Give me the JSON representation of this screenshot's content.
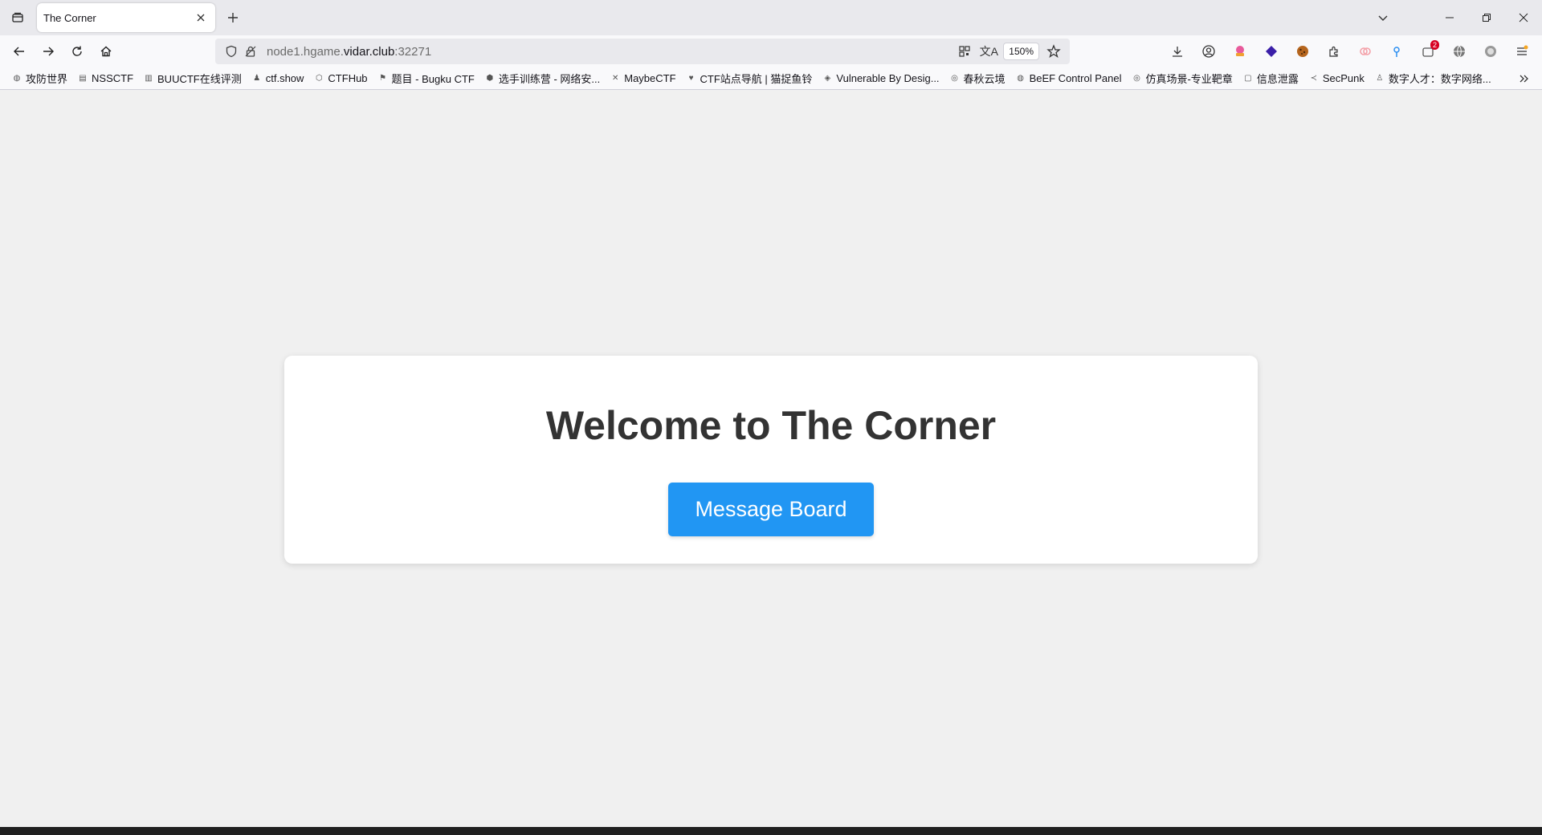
{
  "tab": {
    "title": "The Corner"
  },
  "url": {
    "prefix": "node1.hgame.",
    "domain": "vidar.club",
    "suffix": ":32271"
  },
  "zoom": "150%",
  "extensions": {
    "badge_count": "2"
  },
  "bookmarks": [
    {
      "label": "攻防世界",
      "icon": "globe-icon"
    },
    {
      "label": "NSSCTF",
      "icon": "nss-icon"
    },
    {
      "label": "BUUCTF在线评测",
      "icon": "buu-icon"
    },
    {
      "label": "ctf.show",
      "icon": "runner-icon"
    },
    {
      "label": "CTFHub",
      "icon": "hub-icon"
    },
    {
      "label": "题目 - Bugku CTF",
      "icon": "flag-icon"
    },
    {
      "label": "选手训练营 - 网络安...",
      "icon": "shield-icon"
    },
    {
      "label": "MaybeCTF",
      "icon": "bird-icon"
    },
    {
      "label": "CTF站点导航 | 猫捉鱼铃",
      "icon": "cat-icon"
    },
    {
      "label": "Vulnerable By Desig...",
      "icon": "cube-icon"
    },
    {
      "label": "春秋云境",
      "icon": "swirl-icon"
    },
    {
      "label": "BeEF Control Panel",
      "icon": "globe-icon"
    },
    {
      "label": "仿真场景-专业靶章",
      "icon": "swirl-icon"
    },
    {
      "label": "信息泄露",
      "icon": "square-icon"
    },
    {
      "label": "SecPunk",
      "icon": "arrow-icon"
    },
    {
      "label": "数字人才：数字网络...",
      "icon": "person-icon"
    }
  ],
  "page": {
    "heading": "Welcome to The Corner",
    "button_label": "Message Board"
  },
  "colors": {
    "button_bg": "#2196f3",
    "page_bg": "#f0f0f0",
    "card_bg": "#ffffff",
    "heading": "#333333"
  }
}
